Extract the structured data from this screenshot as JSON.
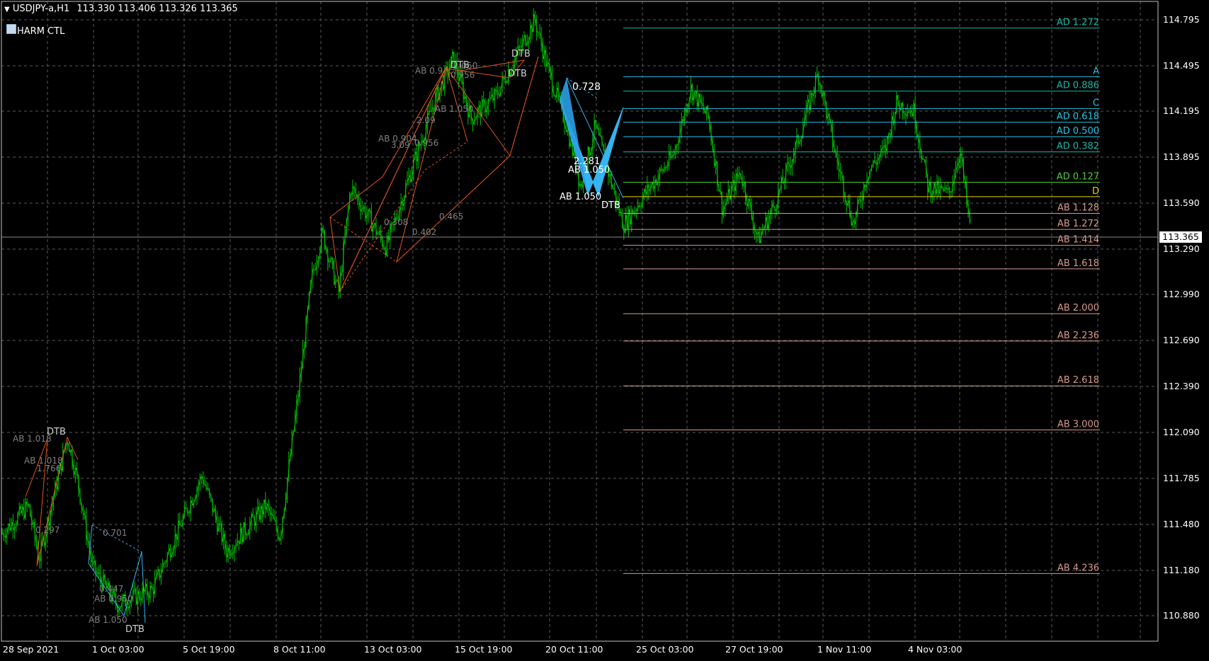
{
  "header": {
    "symbol": "USDJPY-a,H1",
    "ohlc": "113.330 113.406 113.326 113.365",
    "indicator": "HARM CTL"
  },
  "price_axis": [
    "114.795",
    "114.495",
    "114.195",
    "113.895",
    "113.590",
    "113.290",
    "112.990",
    "112.690",
    "112.390",
    "112.090",
    "111.785",
    "111.480",
    "111.180",
    "110.880"
  ],
  "current_price": "113.365",
  "time_axis": [
    "28 Sep 2021",
    "1 Oct 03:00",
    "5 Oct 19:00",
    "8 Oct 11:00",
    "13 Oct 03:00",
    "15 Oct 19:00",
    "20 Oct 11:00",
    "25 Oct 03:00",
    "27 Oct 19:00",
    "1 Nov 11:00",
    "4 Nov 03:00"
  ],
  "levels": [
    {
      "label": "AD 1.272",
      "price": 114.745,
      "color": "#1fb5a8"
    },
    {
      "label": "A",
      "price": 114.425,
      "color": "#25c0e0"
    },
    {
      "label": "AD 0.886",
      "price": 114.33,
      "color": "#1fb5a8"
    },
    {
      "label": "C",
      "price": 114.215,
      "color": "#25c0e0"
    },
    {
      "label": "AD 0.618",
      "price": 114.125,
      "color": "#25c8e8"
    },
    {
      "label": "AD 0.500",
      "price": 114.03,
      "color": "#25c8e8"
    },
    {
      "label": "AD 0.382",
      "price": 113.93,
      "color": "#1fb5a8"
    },
    {
      "label": "AD 0.127",
      "price": 113.73,
      "color": "#4ec93a"
    },
    {
      "label": "D",
      "price": 113.635,
      "color": "#e6d800"
    },
    {
      "label": "AB 1.128",
      "price": 113.525,
      "color": "#d89a8a"
    },
    {
      "label": "AB 1.272",
      "price": 113.42,
      "color": "#d89a8a"
    },
    {
      "label": "AB 1.414",
      "price": 113.315,
      "color": "#d89a8a"
    },
    {
      "label": "AB 1.618",
      "price": 113.16,
      "color": "#d89a8a"
    },
    {
      "label": "AB 2.000",
      "price": 112.865,
      "color": "#d89a8a"
    },
    {
      "label": "AB 2.236",
      "price": 112.685,
      "color": "#d89a8a"
    },
    {
      "label": "AB 2.618",
      "price": 112.39,
      "color": "#d89a8a"
    },
    {
      "label": "AB 3.000",
      "price": 112.1,
      "color": "#d89a8a"
    },
    {
      "label": "AB 4.236",
      "price": 111.155,
      "color": "#d89a8a"
    }
  ],
  "pattern_labels": [
    {
      "text": "0.728",
      "color": "#ffffff"
    },
    {
      "text": "2.281",
      "color": "#ffffff"
    },
    {
      "text": "AB 1.050",
      "color": "#ffffff"
    },
    {
      "text": "AB 1.050",
      "color": "#ffffff"
    },
    {
      "text": "DTB",
      "color": "#ffffff"
    },
    {
      "text": "DTB",
      "color": "#d0d0d0"
    },
    {
      "text": "DTB",
      "color": "#d0d0d0"
    },
    {
      "text": "DTB",
      "color": "#d0d0d0"
    },
    {
      "text": "AB 0.9",
      "color": "#808080"
    },
    {
      "text": "0.956",
      "color": "#808080"
    },
    {
      "text": "1.050",
      "color": "#808080"
    },
    {
      "text": "AB 1.050",
      "color": "#808080"
    },
    {
      "text": "2.09",
      "color": "#808080"
    },
    {
      "text": "AB 0.904",
      "color": "#808080"
    },
    {
      "text": "3.09",
      "color": "#808080"
    },
    {
      "text": "0.956",
      "color": "#808080"
    },
    {
      "text": "0.465",
      "color": "#808080"
    },
    {
      "text": "0.308",
      "color": "#808080"
    },
    {
      "text": "0.402",
      "color": "#808080"
    },
    {
      "text": "DTB",
      "color": "#d0d0d0"
    },
    {
      "text": "AB 1.018",
      "color": "#808080"
    },
    {
      "text": "AB 1.018",
      "color": "#808080"
    },
    {
      "text": "1.766",
      "color": "#808080"
    },
    {
      "text": "0.297",
      "color": "#808080"
    },
    {
      "text": "0.701",
      "color": "#808080"
    },
    {
      "text": "0.447",
      "color": "#808080"
    },
    {
      "text": "AB 0.950",
      "color": "#808080"
    },
    {
      "text": "AB 1.050",
      "color": "#808080"
    },
    {
      "text": "DTB",
      "color": "#d0d0d0"
    }
  ],
  "colors": {
    "background": "#000000",
    "candles": "#00c000",
    "grid": "#6b6b6b",
    "pattern_orange": "#e0541e",
    "pattern_cyan": "#34b4f0"
  }
}
